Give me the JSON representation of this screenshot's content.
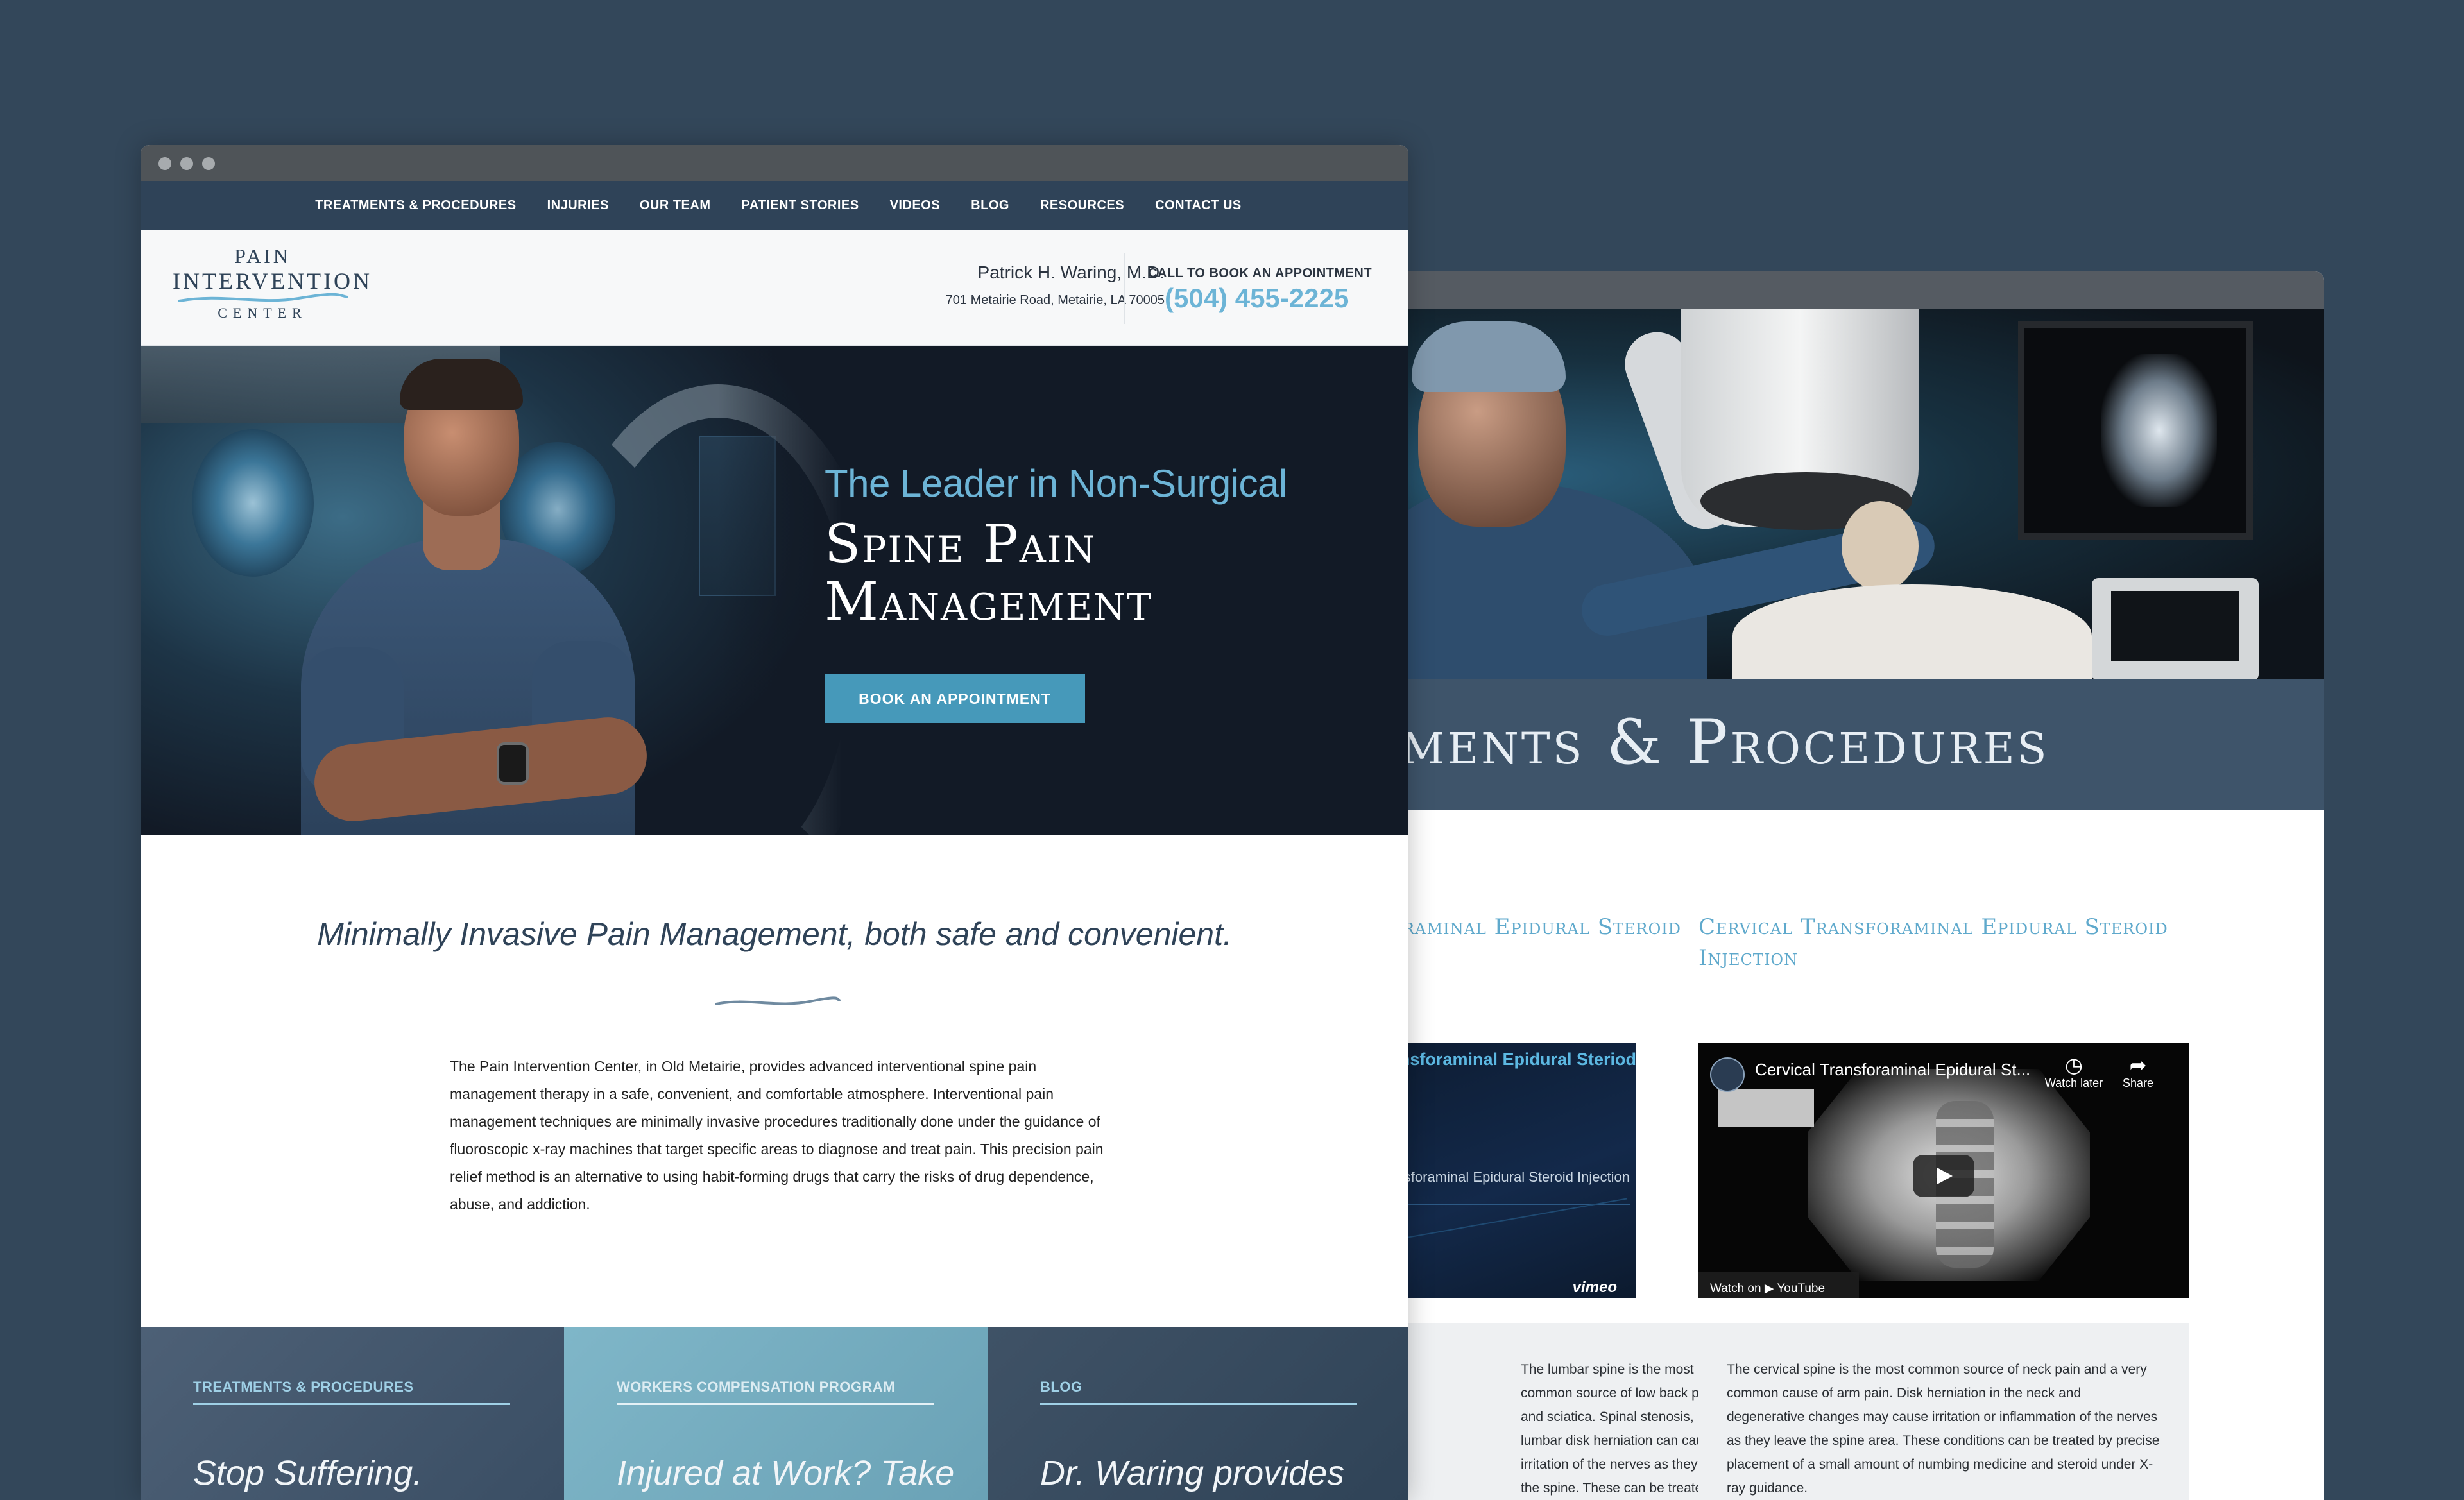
{
  "front": {
    "nav": [
      "TREATMENTS & PROCEDURES",
      "INJURIES",
      "OUR TEAM",
      "PATIENT STORIES",
      "VIDEOS",
      "BLOG",
      "RESOURCES",
      "CONTACT US"
    ],
    "logo": {
      "line1": "PAIN",
      "line2": "INTERVENTION",
      "line3": "CENTER"
    },
    "header": {
      "doctor": "Patrick H. Waring, M.D.",
      "address": "701 Metairie Road, Metairie, LA 70005",
      "call_label": "CALL TO BOOK AN APPOINTMENT",
      "phone": "(504) 455-2225"
    },
    "hero": {
      "eyebrow": "The Leader in Non-Surgical",
      "title_line1": "Spine Pain",
      "title_line2": "Management",
      "cta": "BOOK AN APPOINTMENT"
    },
    "intro": {
      "tagline": "Minimally Invasive Pain Management, both safe and convenient.",
      "body": "The Pain Intervention Center, in Old Metairie, provides advanced interventional spine pain management therapy in a safe, convenient, and comfortable atmosphere. Interventional pain management techniques are minimally invasive procedures traditionally done under the guidance of fluoroscopic x-ray machines that target specific areas to diagnose and treat pain. This precision pain relief method is an alternative to using habit-forming drugs that carry the risks of drug dependence, abuse, and addiction."
    },
    "tiles": [
      {
        "label": "TREATMENTS & PROCEDURES",
        "headline": "Stop Suffering."
      },
      {
        "label": "WORKERS COMPENSATION PROGRAM",
        "headline": "Injured at Work? Take"
      },
      {
        "label": "BLOG",
        "headline": "Dr. Waring provides"
      }
    ]
  },
  "back": {
    "band_title": "Treatments & Procedures",
    "cards": [
      {
        "title": "Lumbar Transforaminal Epidural Steroid",
        "video_title": "Lumbar Transforaminal Epidural Steriod",
        "video_sub": "Lumbar Transforaminal Epidural Steroid Injection",
        "video_brand": "vimeo",
        "desc": "The lumbar spine is the most common source of low back pain and sciatica. Spinal stenosis, or lumbar disk herniation can cause irritation of the nerves as they leave the spine. These can be treated by precise placement of a small amount of numbing medicine and steroid under X-ray guidance."
      },
      {
        "title": "Cervical Transforaminal Epidural Steroid Injection",
        "video_title": "Cervical Transforaminal Epidural St...",
        "watch_later": "Watch later",
        "share": "Share",
        "watch_on": "Watch on  ▶ YouTube",
        "desc": "The cervical spine is the most common source of neck pain and a very common cause of arm pain. Disk herniation in the neck and degenerative changes may cause irritation or inflammation of the nerves as they leave the spine area. These conditions can be treated by precise placement of a small amount of numbing medicine and steroid under X-ray guidance."
      }
    ]
  },
  "colors": {
    "page_bg": "#33475a",
    "nav_bg": "#2f4358",
    "accent_blue": "#6cb4d6",
    "cta_blue": "#4699ba"
  }
}
